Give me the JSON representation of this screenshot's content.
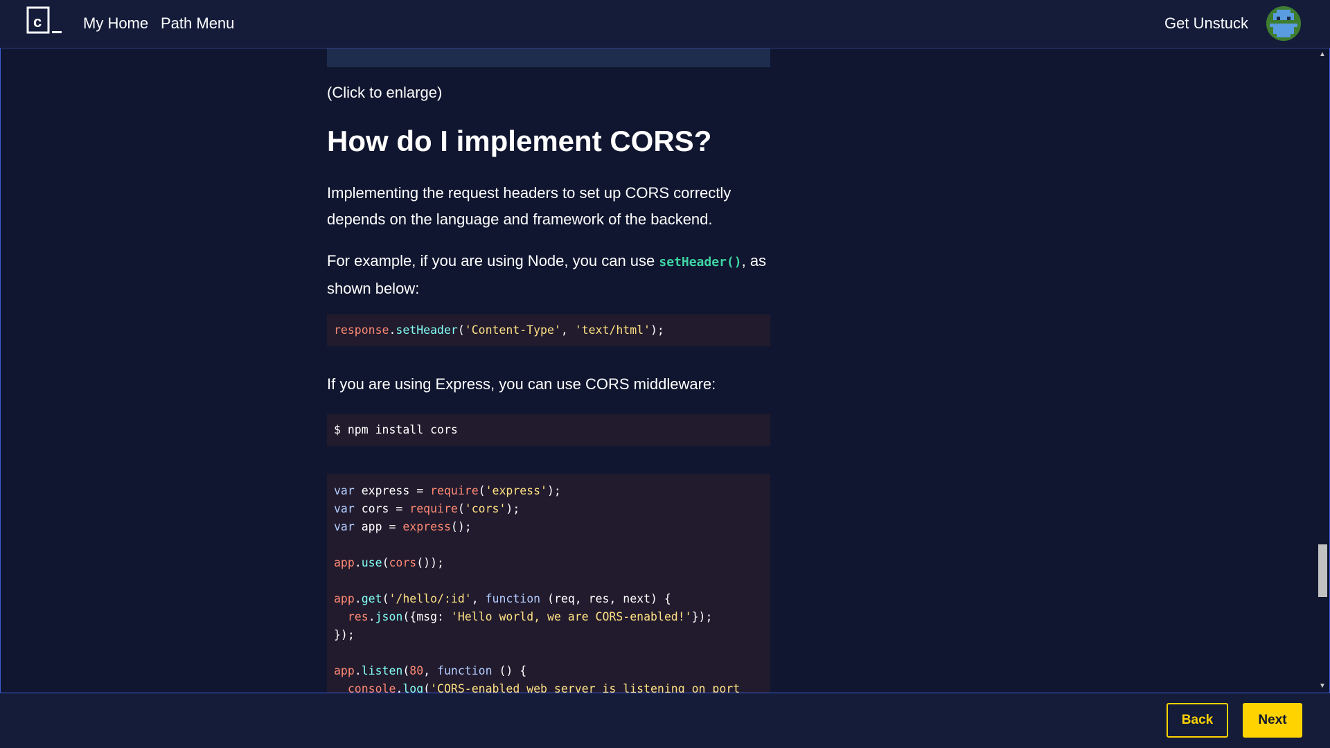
{
  "header": {
    "logo_text": "c_",
    "nav": [
      {
        "label": "My Home"
      },
      {
        "label": "Path Menu"
      }
    ],
    "get_unstuck": "Get Unstuck"
  },
  "article": {
    "caption": "(Click to enlarge)",
    "heading": "How do I implement CORS?",
    "para1": "Implementing the request headers to set up CORS correctly depends on the language and framework of the backend.",
    "para2_before": "For example, if you are using Node, you can use ",
    "para2_code": "setHeader()",
    "para2_after": ", as shown below:",
    "para3": "If you are using Express, you can use CORS middleware:",
    "code1": {
      "obj": "response",
      "dot": ".",
      "method": "setHeader",
      "open": "(",
      "arg1": "'Content-Type'",
      "sep": ", ",
      "arg2": "'text/html'",
      "close": ");"
    },
    "code2": "$ npm install cors",
    "code3": {
      "l1_kw": "var",
      "l1_rest": " express = ",
      "l1_fn": "require",
      "l1_p1": "(",
      "l1_str": "'express'",
      "l1_p2": ");",
      "l2_kw": "var",
      "l2_rest": " cors = ",
      "l2_fn": "require",
      "l2_p1": "(",
      "l2_str": "'cors'",
      "l2_p2": ");",
      "l3_kw": "var",
      "l3_rest": " app = ",
      "l3_fn": "express",
      "l3_p2": "();",
      "l5_obj": "app",
      "l5_dot": ".",
      "l5_method": "use",
      "l5_p1": "(",
      "l5_fn": "cors",
      "l5_p2": "());",
      "l7_obj": "app",
      "l7_dot": ".",
      "l7_method": "get",
      "l7_p1": "(",
      "l7_str": "'/hello/:id'",
      "l7_sep": ", ",
      "l7_kw": "function",
      "l7_args": " (req, res, next) {",
      "l8_indent": "  ",
      "l8_obj": "res",
      "l8_dot": ".",
      "l8_method": "json",
      "l8_p1": "({msg: ",
      "l8_str": "'Hello world, we are CORS-enabled!'",
      "l8_p2": "});",
      "l9": "});",
      "l11_obj": "app",
      "l11_dot": ".",
      "l11_method": "listen",
      "l11_p1": "(",
      "l11_num": "80",
      "l11_sep": ", ",
      "l11_kw": "function",
      "l11_rest": " () {",
      "l12_indent": "  ",
      "l12_obj": "console",
      "l12_dot": ".",
      "l12_method": "log",
      "l12_p1": "(",
      "l12_str": "'CORS-enabled web server is listening on port"
    }
  },
  "footer": {
    "back_label": "Back",
    "next_label": "Next"
  },
  "colors": {
    "accent": "#ffd300",
    "background": "#10162f",
    "inline_code": "#3fd6a5"
  }
}
